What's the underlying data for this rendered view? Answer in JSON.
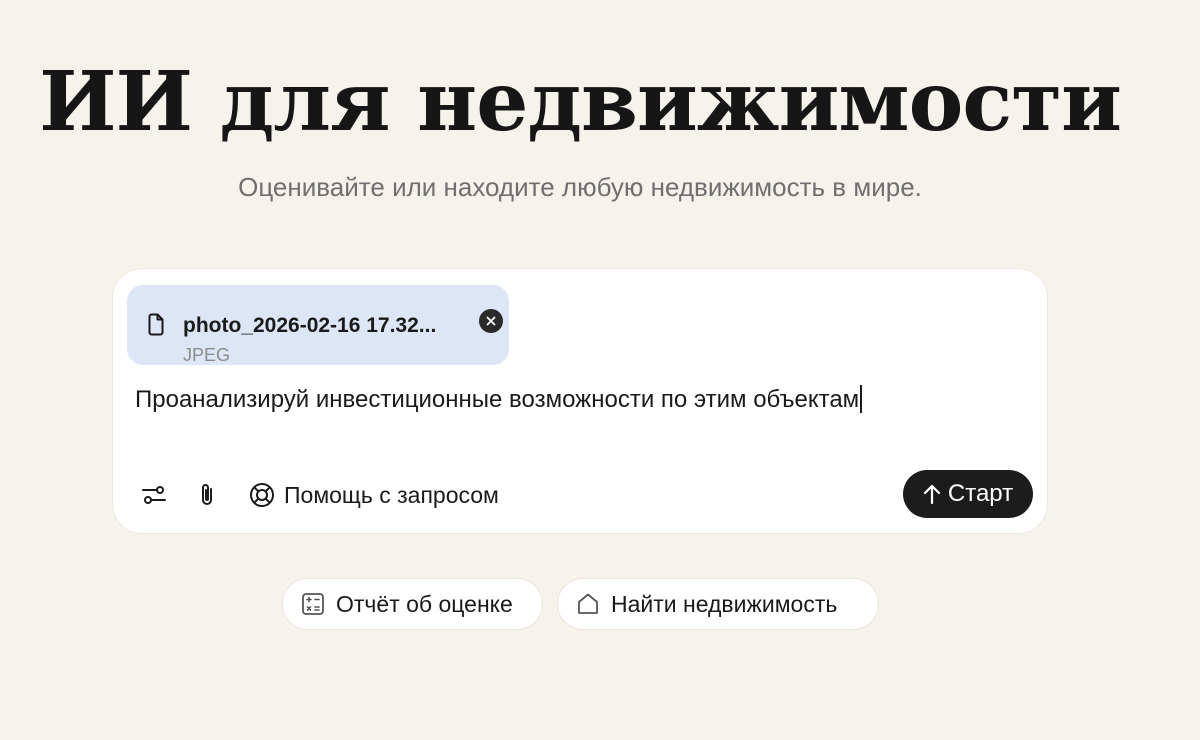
{
  "hero": {
    "title": "ИИ для недвижимости",
    "subtitle": "Оценивайте или находите любую недвижимость в мире."
  },
  "composer": {
    "attachment": {
      "file_name": "photo_2026-02-16 17.32...",
      "file_type": "JPEG",
      "icon": "file-icon",
      "remove_icon": "close-icon"
    },
    "prompt_text": "Проанализируй инвестиционные возможности по этим объектам",
    "toolbar": {
      "settings_icon": "sliders-icon",
      "attach_icon": "paperclip-icon",
      "help_label": "Помощь с запросом",
      "help_icon": "lifebuoy-icon",
      "start_label": "Старт",
      "start_icon": "arrow-up-icon"
    }
  },
  "quick_actions": [
    {
      "label": "Отчёт об оценке",
      "icon": "calculator-icon"
    },
    {
      "label": "Найти недвижимость",
      "icon": "home-icon"
    }
  ],
  "colors": {
    "background": "#f6f3ec",
    "attachment_bg": "#dce6f6",
    "start_button_bg": "#1c1c1c"
  }
}
